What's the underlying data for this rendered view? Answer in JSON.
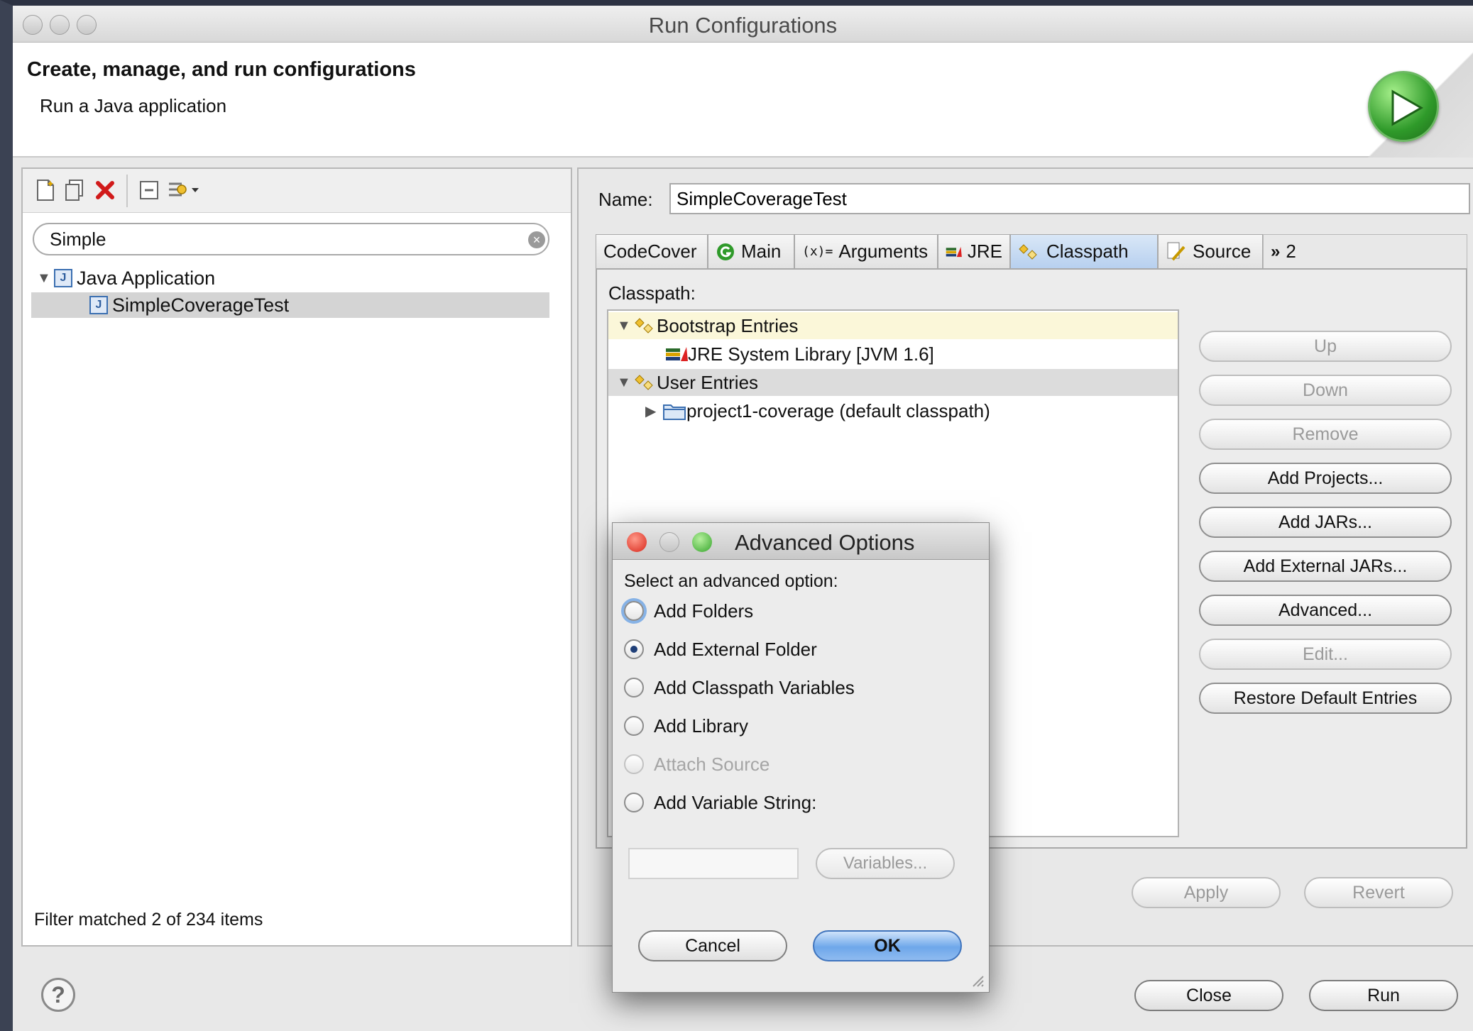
{
  "window": {
    "title": "Run Configurations"
  },
  "header": {
    "title": "Create, manage, and run configurations",
    "subtitle": "Run a Java application"
  },
  "left": {
    "filter_value": "Simple",
    "tree": [
      {
        "label": "Java Application",
        "type": "category"
      },
      {
        "label": "SimpleCoverageTest",
        "type": "configuration",
        "selected": true
      }
    ],
    "status": "Filter matched 2 of 234 items"
  },
  "right": {
    "name_label": "Name:",
    "name_value": "SimpleCoverageTest",
    "tabs": [
      {
        "label": "CodeCover",
        "icon": "none"
      },
      {
        "label": "Main",
        "icon": "main-tab-icon"
      },
      {
        "label": "Arguments",
        "icon": "arguments-icon"
      },
      {
        "label": "JRE",
        "icon": "jre-library-icon"
      },
      {
        "label": "Classpath",
        "icon": "classpath-icon",
        "active": true
      },
      {
        "label": "Source",
        "icon": "source-icon"
      },
      {
        "label": "2",
        "icon": "overflow-chevrons-icon"
      }
    ],
    "classpath_label": "Classpath:",
    "classpath_tree": [
      {
        "label": "Bootstrap Entries"
      },
      {
        "label": "JRE System Library [JVM 1.6]"
      },
      {
        "label": "User Entries"
      },
      {
        "label": "project1-coverage (default classpath)"
      }
    ],
    "buttons": {
      "up": "Up",
      "down": "Down",
      "remove": "Remove",
      "add_projects": "Add Projects...",
      "add_jars": "Add JARs...",
      "add_external_jars": "Add External JARs...",
      "advanced": "Advanced...",
      "edit": "Edit...",
      "restore_defaults": "Restore Default Entries",
      "apply": "Apply",
      "revert": "Revert"
    }
  },
  "footer": {
    "close": "Close",
    "run": "Run"
  },
  "dialog": {
    "title": "Advanced Options",
    "prompt": "Select an advanced option:",
    "options": [
      {
        "label": "Add Folders",
        "checked": false,
        "disabled": false
      },
      {
        "label": "Add External Folder",
        "checked": true,
        "disabled": false
      },
      {
        "label": "Add Classpath Variables",
        "checked": false,
        "disabled": false
      },
      {
        "label": "Add Library",
        "checked": false,
        "disabled": false
      },
      {
        "label": "Attach Source",
        "checked": false,
        "disabled": true
      },
      {
        "label": "Add Variable String:",
        "checked": false,
        "disabled": false
      }
    ],
    "variable_value": "",
    "variables_button": "Variables...",
    "cancel": "Cancel",
    "ok": "OK"
  },
  "colors": {
    "selection": "#d4d4d4",
    "bootstrap_highlight": "#fbf7d9",
    "active_tab": "#b7d0ef",
    "ok_button": "#6ea7ea",
    "run_badge": "#2f9a2a"
  }
}
